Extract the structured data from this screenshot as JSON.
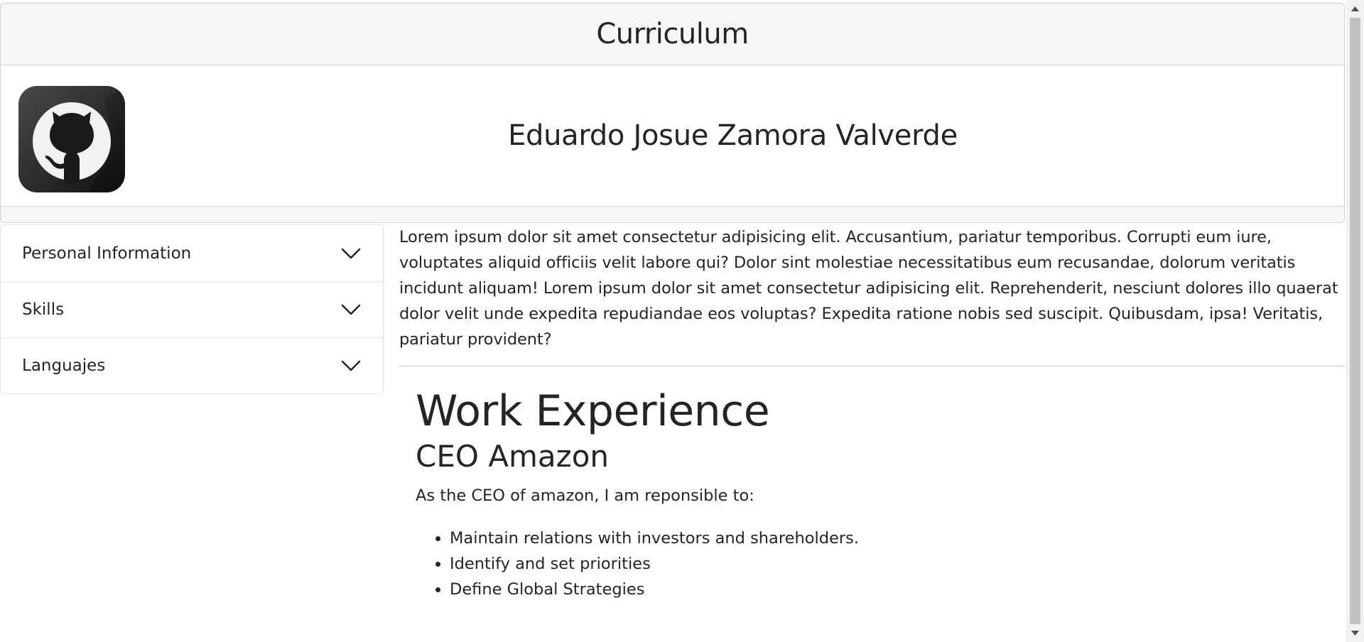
{
  "header": {
    "title": "Curriculum"
  },
  "profile": {
    "name": "Eduardo Josue Zamora Valverde",
    "logo_icon": "github-icon"
  },
  "accordion": {
    "items": [
      {
        "label": "Personal Information",
        "icon": "chevron-down-icon"
      },
      {
        "label": "Skills",
        "icon": "chevron-down-icon"
      },
      {
        "label": "Languajes",
        "icon": "chevron-down-icon"
      }
    ]
  },
  "main": {
    "intro": "Lorem ipsum dolor sit amet consectetur adipisicing elit. Accusantium, pariatur temporibus. Corrupti eum iure, voluptates aliquid officiis velit labore qui? Dolor sint molestiae necessitatibus eum recusandae, dolorum veritatis incidunt aliquam! Lorem ipsum dolor sit amet consectetur adipisicing elit. Reprehenderit, nesciunt dolores illo quaerat dolor velit unde expedita repudiandae eos voluptas? Expedita ratione nobis sed suscipit. Quibusdam, ipsa! Veritatis, pariatur provident?",
    "work": {
      "heading": "Work Experience",
      "job_title": "CEO Amazon",
      "description": "As the CEO of amazon, I am reponsible to:",
      "duties": [
        "Maintain relations with investors and shareholders.",
        "Identify and set priorities",
        "Define Global Strategies"
      ]
    }
  },
  "colors": {
    "text": "#212529",
    "header_bg": "#f7f7f7",
    "border": "#dee2e6"
  }
}
